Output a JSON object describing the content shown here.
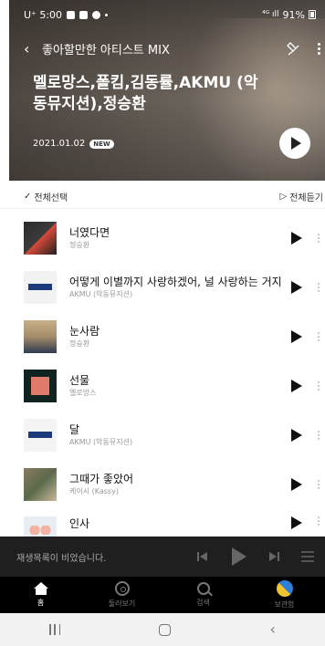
{
  "status_bar": {
    "carrier_time": "U⁺ 5:00",
    "battery": "91%"
  },
  "header": {
    "title": "좋아할만한 아티스트 MIX",
    "headline": "멜로망스,폴킴,김동률,AKMU (악동뮤지션),정승환",
    "date": "2021.01.02",
    "badge": "NEW"
  },
  "select_bar": {
    "select_all": "전체선택",
    "play_all": "전체듣기"
  },
  "songs": [
    {
      "title": "너였다면",
      "artist": "정승환"
    },
    {
      "title": "어떻게 이별까지 사랑하겠어, 널 사랑하는 거지",
      "artist": "AKMU (악동뮤지션)"
    },
    {
      "title": "눈사람",
      "artist": "정승환"
    },
    {
      "title": "선물",
      "artist": "멜로망스"
    },
    {
      "title": "달",
      "artist": "AKMU (악동뮤지션)"
    },
    {
      "title": "그때가 좋았어",
      "artist": "케이시 (Kassy)"
    },
    {
      "title": "인사",
      "artist": ""
    }
  ],
  "player": {
    "empty_text": "재생목록이 비었습니다."
  },
  "nav": {
    "home": "홈",
    "browse": "둘러보기",
    "search": "검색",
    "library": "보관함"
  }
}
